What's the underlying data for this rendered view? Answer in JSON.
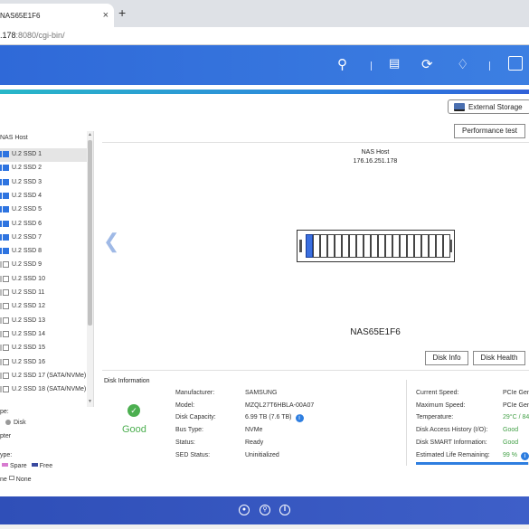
{
  "browser": {
    "tab_title": "NAS65E1F6",
    "tab_close": "×",
    "new_tab": "+",
    "url_host": ".178",
    "url_rest": ":8080/cgi-bin/"
  },
  "header_icons": [
    "search-icon",
    "task-icon",
    "sync-icon",
    "bell-icon",
    "user-icon"
  ],
  "toolbar": {
    "external_storage": "External Storage",
    "performance_test": "Performance test"
  },
  "tree": {
    "root": "NAS Host",
    "items": [
      {
        "label": "U.2 SSD 1",
        "checked": true,
        "selected": true
      },
      {
        "label": "U.2 SSD 2",
        "checked": true
      },
      {
        "label": "U.2 SSD 3",
        "checked": true
      },
      {
        "label": "U.2 SSD 4",
        "checked": true
      },
      {
        "label": "U.2 SSD 5",
        "checked": true
      },
      {
        "label": "U.2 SSD 6",
        "checked": true
      },
      {
        "label": "U.2 SSD 7",
        "checked": true
      },
      {
        "label": "U.2 SSD 8",
        "checked": true
      },
      {
        "label": "U.2 SSD 9",
        "checked": false
      },
      {
        "label": "U.2 SSD 10",
        "checked": false
      },
      {
        "label": "U.2 SSD 11",
        "checked": false
      },
      {
        "label": "U.2 SSD 12",
        "checked": false
      },
      {
        "label": "U.2 SSD 13",
        "checked": false
      },
      {
        "label": "U.2 SSD 14",
        "checked": false
      },
      {
        "label": "U.2 SSD 15",
        "checked": false
      },
      {
        "label": "U.2 SSD 16",
        "checked": false
      },
      {
        "label": "U.2 SSD 17 (SATA/NVMe)",
        "checked": false
      },
      {
        "label": "U.2 SSD 18 (SATA/NVMe)",
        "checked": false
      }
    ]
  },
  "legend": {
    "type1_label": "pe:",
    "disk": "Disk",
    "pter": "pter",
    "type2_label": "ype:",
    "spare": "Spare",
    "free": "Free",
    "none_prefix": "ne",
    "none": "None"
  },
  "visual": {
    "host_title": "NAS Host",
    "host_ip": "176.16.251.178",
    "nas_name": "NAS65E1F6",
    "disk_info_btn": "Disk Info",
    "disk_health_btn": "Disk Health",
    "slot_count": 20,
    "active_slot": 1
  },
  "disk_info": {
    "section_title": "Disk Information",
    "status": "Good",
    "left": [
      {
        "k": "Manufacturer:",
        "v": "SAMSUNG"
      },
      {
        "k": "Model:",
        "v": "MZQL27T6HBLA-00A07"
      },
      {
        "k": "Disk Capacity:",
        "v": "6.99 TB (7.6 TB)"
      },
      {
        "k": "Bus Type:",
        "v": "NVMe"
      },
      {
        "k": "Status:",
        "v": "Ready"
      },
      {
        "k": "SED Status:",
        "v": "Uninitialized"
      }
    ],
    "right": [
      {
        "k": "Current Speed:",
        "v": "PCIe Gen"
      },
      {
        "k": "Maximum Speed:",
        "v": "PCIe Gen"
      },
      {
        "k": "Temperature:",
        "v": "29°C / 84"
      },
      {
        "k": "Disk Access History (I/O):",
        "v": "Good"
      },
      {
        "k": "Disk SMART Information:",
        "v": "Good"
      },
      {
        "k": "Estimated Life Remaining:",
        "v": "99 %"
      }
    ],
    "life_remaining_pct": 99
  },
  "footer_icons": [
    "dashboard-icon",
    "search-icon",
    "pause-icon"
  ]
}
